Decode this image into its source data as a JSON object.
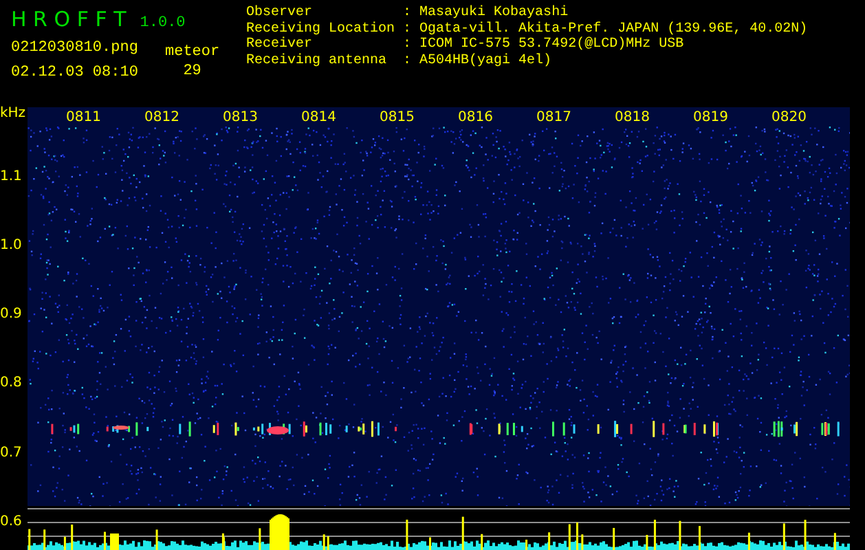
{
  "app": {
    "title": "H R O F F T",
    "version": "1.0.0"
  },
  "file": {
    "name": "0212030810.png",
    "datetime": "02.12.03 08:10"
  },
  "meteor": {
    "label": "meteor",
    "count": "29"
  },
  "info": [
    {
      "label": "Observer",
      "separator": ":",
      "value": "Masayuki Kobayashi"
    },
    {
      "label": "Receiving Location",
      "separator": ":",
      "value": "Ogata-vill. Akita-Pref. JAPAN (139.96E, 40.02N)"
    },
    {
      "label": "Receiver",
      "separator": ":",
      "value": "ICOM IC-575 53.7492(@LCD)MHz USB"
    },
    {
      "label": "Receiving antenna",
      "separator": ":",
      "value": "A504HB(yagi 4el)"
    }
  ],
  "spectrogram": {
    "unit": "kHz",
    "y_labels": [
      "1.1",
      "1.0",
      "0.9",
      "0.8",
      "0.7",
      "0.6"
    ],
    "time_labels": [
      "0811",
      "0812",
      "0813",
      "0814",
      "0815",
      "0816",
      "0817",
      "0818",
      "0819",
      "0820"
    ]
  }
}
